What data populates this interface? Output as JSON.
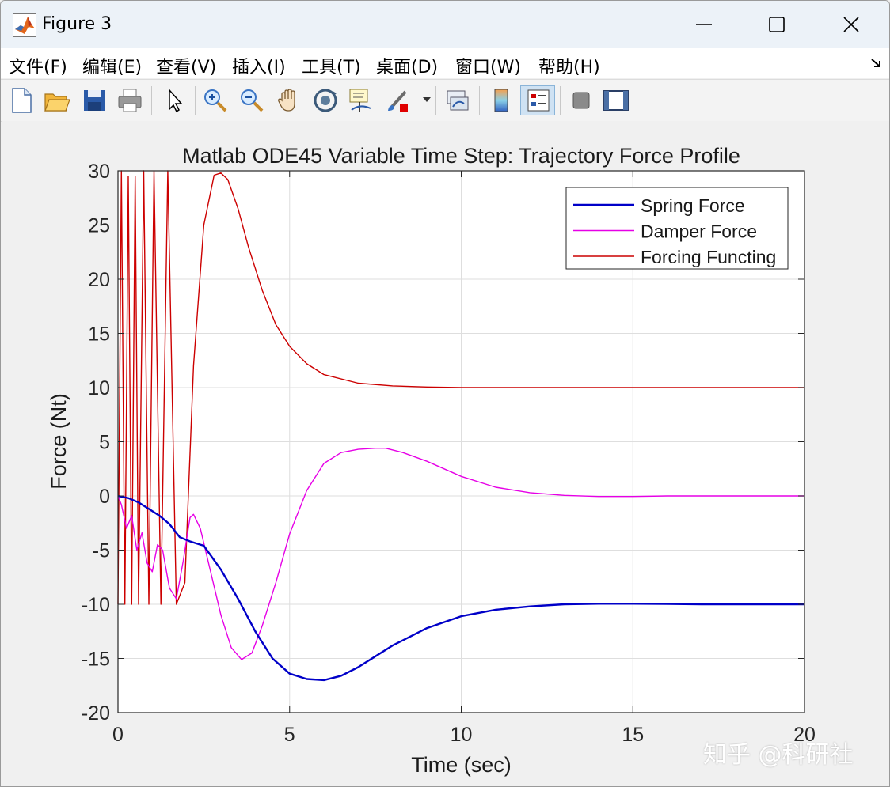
{
  "window": {
    "title": "Figure 3"
  },
  "menu": [
    "文件(F)",
    "编辑(E)",
    "查看(V)",
    "插入(I)",
    "工具(T)",
    "桌面(D)",
    "窗口(W)",
    "帮助(H)"
  ],
  "toolbar": [
    {
      "name": "new-figure-icon"
    },
    {
      "name": "open-file-icon"
    },
    {
      "name": "save-icon"
    },
    {
      "name": "print-icon"
    },
    {
      "name": "pointer-icon"
    },
    {
      "name": "zoom-in-icon"
    },
    {
      "name": "zoom-out-icon"
    },
    {
      "name": "pan-hand-icon"
    },
    {
      "name": "rotate-3d-icon"
    },
    {
      "name": "data-cursor-icon"
    },
    {
      "name": "brush-icon"
    },
    {
      "name": "link-plot-icon"
    },
    {
      "name": "colorbar-icon"
    },
    {
      "name": "legend-icon"
    },
    {
      "name": "hide-plot-tools-icon"
    },
    {
      "name": "show-plot-tools-icon"
    }
  ],
  "watermark": "知乎 @科研社",
  "colors": {
    "spring": "#0000c8",
    "damper": "#e600e6",
    "forcing": "#cc0000",
    "grid": "#dedede"
  },
  "chart_data": {
    "type": "line",
    "title": "Matlab ODE45 Variable Time Step:  Trajectory Force Profile",
    "xlabel": "Time (sec)",
    "ylabel": "Force (Nt)",
    "xlim": [
      0,
      20
    ],
    "ylim": [
      -20,
      30
    ],
    "xticks": [
      0,
      5,
      10,
      15,
      20
    ],
    "yticks": [
      -20,
      -15,
      -10,
      -5,
      0,
      5,
      10,
      15,
      20,
      25,
      30
    ],
    "grid": true,
    "legend": "top-right",
    "series": [
      {
        "name": "Spring Force",
        "x": [
          0,
          0.3,
          0.6,
          0.9,
          1.2,
          1.5,
          1.8,
          2.1,
          2.5,
          3.0,
          3.5,
          4.0,
          4.5,
          5.0,
          5.5,
          6.0,
          6.5,
          7.0,
          7.5,
          8.0,
          9.0,
          10.0,
          11.0,
          12.0,
          13.0,
          14.0,
          15.0,
          16.0,
          17.0,
          18.0,
          19.0,
          20.0
        ],
        "y": [
          0,
          -0.2,
          -0.6,
          -1.2,
          -1.8,
          -2.6,
          -3.8,
          -4.2,
          -4.6,
          -6.8,
          -9.5,
          -12.5,
          -15.0,
          -16.4,
          -16.9,
          -17.0,
          -16.6,
          -15.8,
          -14.8,
          -13.8,
          -12.2,
          -11.1,
          -10.5,
          -10.2,
          -10.0,
          -9.95,
          -9.95,
          -9.97,
          -10.0,
          -10.0,
          -10.0,
          -10.0
        ]
      },
      {
        "name": "Damper Force",
        "x": [
          0,
          0.1,
          0.25,
          0.4,
          0.55,
          0.7,
          0.85,
          1.0,
          1.15,
          1.3,
          1.5,
          1.7,
          1.9,
          2.1,
          2.2,
          2.4,
          2.7,
          3.0,
          3.3,
          3.6,
          3.9,
          4.2,
          4.6,
          5.0,
          5.5,
          6.0,
          6.5,
          7.0,
          7.5,
          7.8,
          8.3,
          9.0,
          10.0,
          11.0,
          12.0,
          13.0,
          14.0,
          15.0,
          16.0,
          17.0,
          18.0,
          20.0
        ],
        "y": [
          0,
          -0.8,
          -3.0,
          -1.8,
          -5.0,
          -3.4,
          -6.2,
          -7.0,
          -4.5,
          -5.0,
          -8.5,
          -9.5,
          -6.0,
          -2.0,
          -1.7,
          -3.0,
          -7.0,
          -11.0,
          -14.0,
          -15.1,
          -14.5,
          -12.0,
          -8.0,
          -3.5,
          0.5,
          3.0,
          4.0,
          4.3,
          4.4,
          4.4,
          4.0,
          3.2,
          1.8,
          0.8,
          0.3,
          0.05,
          -0.05,
          -0.05,
          0.0,
          0.0,
          0.0,
          0.0
        ]
      },
      {
        "name": "Forcing Functing",
        "x": [
          0,
          0.1,
          0.2,
          0.3,
          0.4,
          0.5,
          0.6,
          0.75,
          0.9,
          1.05,
          1.25,
          1.45,
          1.7,
          1.95,
          2.2,
          2.5,
          2.8,
          3.0,
          3.2,
          3.5,
          3.8,
          4.2,
          4.6,
          5.0,
          5.5,
          6.0,
          7.0,
          8.0,
          9.0,
          10.0,
          12.0,
          14.0,
          16.0,
          18.0,
          20.0
        ],
        "y": [
          -10,
          30,
          -10,
          29.5,
          -10,
          29.5,
          -10,
          30,
          -10,
          30,
          -10,
          30,
          -10,
          -8,
          12,
          25,
          29.6,
          29.8,
          29.2,
          26.5,
          23.0,
          19.0,
          15.8,
          13.8,
          12.2,
          11.2,
          10.4,
          10.15,
          10.05,
          10.0,
          10.0,
          10.0,
          10.0,
          10.0,
          10.0
        ]
      }
    ]
  }
}
